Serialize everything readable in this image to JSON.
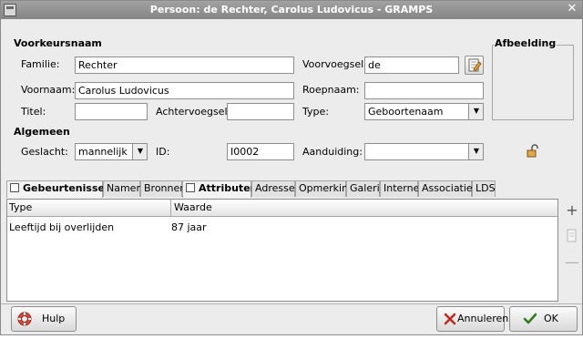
{
  "window": {
    "title": "Persoon: de Rechter, Carolus Ludovicus - GRAMPS"
  },
  "name_section": {
    "heading": "Voorkeursnaam",
    "familie_label": "Familie:",
    "familie_value": "Rechter",
    "voorvoegsel_label": "Voorvoegsel:",
    "voorvoegsel_value": "de",
    "voornaam_label": "Voornaam:",
    "voornaam_value": "Carolus Ludovicus",
    "roepnaam_label": "Roepnaam:",
    "roepnaam_value": "",
    "titel_label": "Titel:",
    "titel_value": "",
    "achtervoegsel_label": "Achtervoegsel:",
    "achtervoegsel_value": "",
    "type_label": "Type:",
    "type_value": "Geboortenaam"
  },
  "image_section": {
    "heading": "Afbeelding"
  },
  "general_section": {
    "heading": "Algemeen",
    "geslacht_label": "Geslacht:",
    "geslacht_value": "mannelijk",
    "id_label": "ID:",
    "id_value": "I0002",
    "aanduiding_label": "Aanduiding:",
    "aanduiding_value": ""
  },
  "tabs": [
    {
      "label": "Gebeurtenissen"
    },
    {
      "label": "Namen"
    },
    {
      "label": "Bronnen"
    },
    {
      "label": "Attributen"
    },
    {
      "label": "Adressen"
    },
    {
      "label": "Opmerking"
    },
    {
      "label": "Galerij"
    },
    {
      "label": "Internet"
    },
    {
      "label": "Associaties"
    },
    {
      "label": "LDS"
    }
  ],
  "attributes_table": {
    "columns": [
      "Type",
      "Waarde"
    ],
    "rows": [
      {
        "type": "Leeftijd bij overlijden",
        "value": "87 jaar"
      }
    ]
  },
  "buttons": {
    "help": "Hulp",
    "cancel": "Annuleren",
    "ok": "OK"
  },
  "icons": {
    "edit_name": "edit-name-icon",
    "privacy": "lock-open-icon",
    "add": "add-icon",
    "edit": "edit-icon",
    "remove": "remove-icon"
  }
}
